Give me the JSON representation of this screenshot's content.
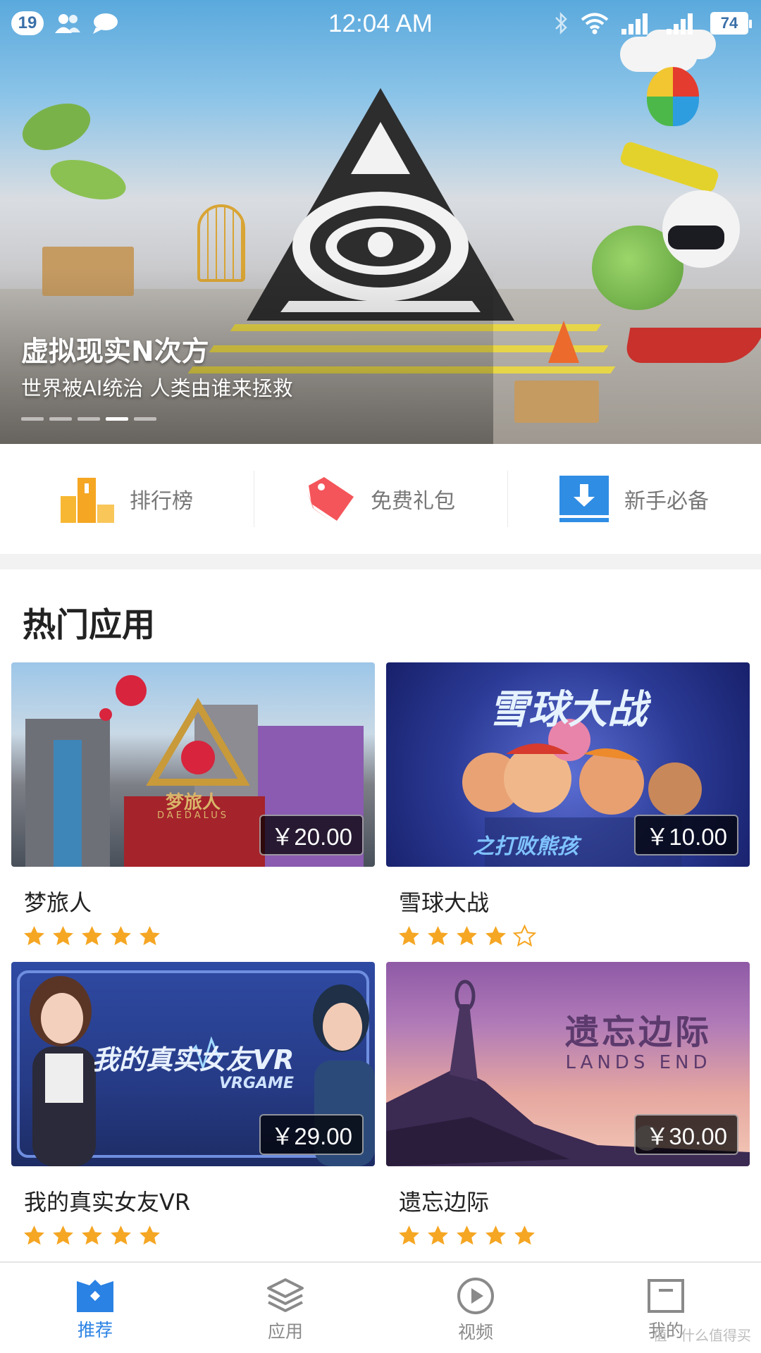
{
  "status_bar": {
    "notification_count": "19",
    "time": "12:04 AM",
    "battery": "74",
    "icons": [
      "contacts-icon",
      "message-icon",
      "bluetooth-icon",
      "wifi-icon",
      "signal-icon",
      "signal-icon",
      "battery-icon"
    ]
  },
  "banner": {
    "title": "虚拟现实N次方",
    "subtitle": "世界被AI统治 人类由谁来拯救",
    "slide_count": 5,
    "active_slide": 4
  },
  "quick_nav": [
    {
      "label": "排行榜",
      "icon": "ranking-icon",
      "color": "#f5a623"
    },
    {
      "label": "免费礼包",
      "icon": "gift-tag-icon",
      "color": "#f4555a"
    },
    {
      "label": "新手必备",
      "icon": "download-icon",
      "color": "#2f8de4"
    }
  ],
  "hot_apps": {
    "title": "热门应用",
    "apps": [
      {
        "name": "梦旅人",
        "price": "￥20.00",
        "rating": 5,
        "thumb_title": "梦旅人",
        "thumb_subtitle": "DAEDALUS"
      },
      {
        "name": "雪球大战",
        "price": "￥10.00",
        "rating": 4,
        "thumb_title": "雪球大战",
        "thumb_subtitle": "之打败熊孩"
      },
      {
        "name": "我的真实女友VR",
        "price": "￥29.00",
        "rating": 5,
        "thumb_title": "我的真实女友VR",
        "thumb_subtitle": "VRGAME"
      },
      {
        "name": "遗忘边际",
        "price": "￥30.00",
        "rating": 5,
        "thumb_title": "遗忘边际",
        "thumb_subtitle": "LANDS END"
      }
    ]
  },
  "bottom_nav": [
    {
      "label": "推荐",
      "icon": "recommend-icon",
      "active": true
    },
    {
      "label": "应用",
      "icon": "apps-icon",
      "active": false
    },
    {
      "label": "视频",
      "icon": "video-icon",
      "active": false
    },
    {
      "label": "我的",
      "icon": "profile-icon",
      "active": false
    }
  ],
  "watermark": "值 · 什么值得买",
  "colors": {
    "accent": "#2a82e4",
    "star": "#f5a623",
    "price_bg": "#000000"
  }
}
